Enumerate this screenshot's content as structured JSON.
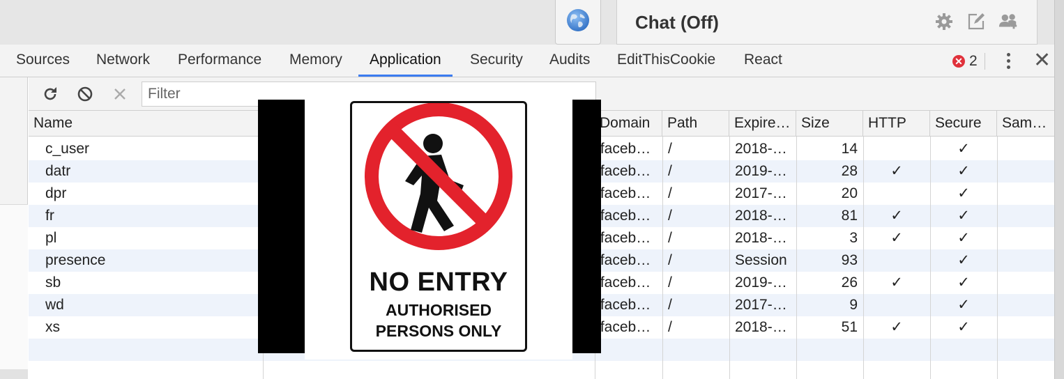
{
  "chat": {
    "title": "Chat (Off)",
    "icons": [
      "gear-icon",
      "compose-icon",
      "add-people-icon"
    ]
  },
  "devtools": {
    "tabs": [
      "Sources",
      "Network",
      "Performance",
      "Memory",
      "Application",
      "Security",
      "Audits",
      "EditThisCookie",
      "React"
    ],
    "active_tab": "Application",
    "error_count": "2",
    "error_glyph": "✕",
    "kebab_icon": "more-vert-icon",
    "close_glyph": "✕"
  },
  "toolbar": {
    "filter_placeholder": "Filter",
    "icons": [
      "refresh-icon",
      "clear-icon",
      "delete-icon"
    ]
  },
  "cookies": {
    "columns": [
      "Name",
      "Domain",
      "Path",
      "Expire…",
      "Size",
      "HTTP",
      "Secure",
      "Same…"
    ],
    "rows": [
      {
        "name": "c_user",
        "domain": ".faceb…",
        "path": "/",
        "expires": "2018-…",
        "size": "14",
        "http": "",
        "secure": "✓"
      },
      {
        "name": "datr",
        "domain": ".faceb…",
        "path": "/",
        "expires": "2019-…",
        "size": "28",
        "http": "✓",
        "secure": "✓"
      },
      {
        "name": "dpr",
        "domain": ".faceb…",
        "path": "/",
        "expires": "2017-…",
        "size": "20",
        "http": "",
        "secure": "✓"
      },
      {
        "name": "fr",
        "domain": ".faceb…",
        "path": "/",
        "expires": "2018-…",
        "size": "81",
        "http": "✓",
        "secure": "✓"
      },
      {
        "name": "pl",
        "domain": ".faceb…",
        "path": "/",
        "expires": "2018-…",
        "size": "3",
        "http": "✓",
        "secure": "✓"
      },
      {
        "name": "presence",
        "domain": ".faceb…",
        "path": "/",
        "expires": "Session",
        "size": "93",
        "http": "",
        "secure": "✓"
      },
      {
        "name": "sb",
        "domain": ".faceb…",
        "path": "/",
        "expires": "2019-…",
        "size": "26",
        "http": "✓",
        "secure": "✓"
      },
      {
        "name": "wd",
        "domain": ".faceb…",
        "path": "/",
        "expires": "2017-…",
        "size": "9",
        "http": "",
        "secure": "✓"
      },
      {
        "name": "xs",
        "domain": ".faceb…",
        "path": "/",
        "expires": "2018-…",
        "size": "51",
        "http": "✓",
        "secure": "✓"
      }
    ]
  },
  "sign": {
    "title": "NO ENTRY",
    "line1": "AUTHORISED",
    "line2": "PERSONS ONLY",
    "colors": {
      "ring": "#e3222c",
      "figure": "#111111"
    }
  },
  "colors": {
    "accent": "#3b7cf0",
    "error": "#e0313b",
    "row_stripe": "#eef3fb"
  }
}
